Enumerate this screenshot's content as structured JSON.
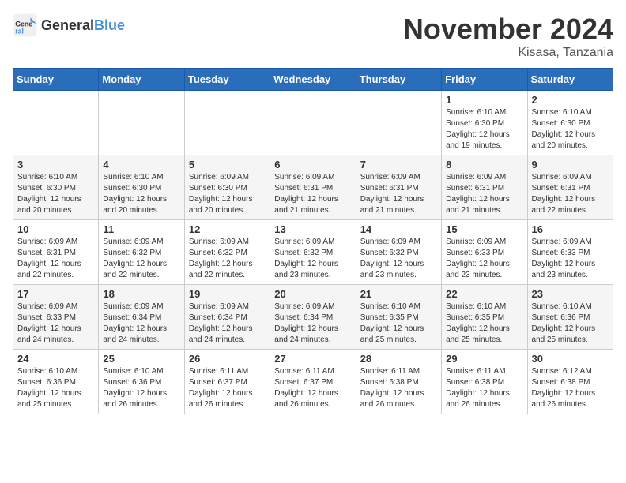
{
  "logo": {
    "general": "General",
    "blue": "Blue"
  },
  "header": {
    "month": "November 2024",
    "location": "Kisasa, Tanzania"
  },
  "weekdays": [
    "Sunday",
    "Monday",
    "Tuesday",
    "Wednesday",
    "Thursday",
    "Friday",
    "Saturday"
  ],
  "weeks": [
    [
      {
        "day": "",
        "info": ""
      },
      {
        "day": "",
        "info": ""
      },
      {
        "day": "",
        "info": ""
      },
      {
        "day": "",
        "info": ""
      },
      {
        "day": "",
        "info": ""
      },
      {
        "day": "1",
        "info": "Sunrise: 6:10 AM\nSunset: 6:30 PM\nDaylight: 12 hours and 19 minutes."
      },
      {
        "day": "2",
        "info": "Sunrise: 6:10 AM\nSunset: 6:30 PM\nDaylight: 12 hours and 20 minutes."
      }
    ],
    [
      {
        "day": "3",
        "info": "Sunrise: 6:10 AM\nSunset: 6:30 PM\nDaylight: 12 hours and 20 minutes."
      },
      {
        "day": "4",
        "info": "Sunrise: 6:10 AM\nSunset: 6:30 PM\nDaylight: 12 hours and 20 minutes."
      },
      {
        "day": "5",
        "info": "Sunrise: 6:09 AM\nSunset: 6:30 PM\nDaylight: 12 hours and 20 minutes."
      },
      {
        "day": "6",
        "info": "Sunrise: 6:09 AM\nSunset: 6:31 PM\nDaylight: 12 hours and 21 minutes."
      },
      {
        "day": "7",
        "info": "Sunrise: 6:09 AM\nSunset: 6:31 PM\nDaylight: 12 hours and 21 minutes."
      },
      {
        "day": "8",
        "info": "Sunrise: 6:09 AM\nSunset: 6:31 PM\nDaylight: 12 hours and 21 minutes."
      },
      {
        "day": "9",
        "info": "Sunrise: 6:09 AM\nSunset: 6:31 PM\nDaylight: 12 hours and 22 minutes."
      }
    ],
    [
      {
        "day": "10",
        "info": "Sunrise: 6:09 AM\nSunset: 6:31 PM\nDaylight: 12 hours and 22 minutes."
      },
      {
        "day": "11",
        "info": "Sunrise: 6:09 AM\nSunset: 6:32 PM\nDaylight: 12 hours and 22 minutes."
      },
      {
        "day": "12",
        "info": "Sunrise: 6:09 AM\nSunset: 6:32 PM\nDaylight: 12 hours and 22 minutes."
      },
      {
        "day": "13",
        "info": "Sunrise: 6:09 AM\nSunset: 6:32 PM\nDaylight: 12 hours and 23 minutes."
      },
      {
        "day": "14",
        "info": "Sunrise: 6:09 AM\nSunset: 6:32 PM\nDaylight: 12 hours and 23 minutes."
      },
      {
        "day": "15",
        "info": "Sunrise: 6:09 AM\nSunset: 6:33 PM\nDaylight: 12 hours and 23 minutes."
      },
      {
        "day": "16",
        "info": "Sunrise: 6:09 AM\nSunset: 6:33 PM\nDaylight: 12 hours and 23 minutes."
      }
    ],
    [
      {
        "day": "17",
        "info": "Sunrise: 6:09 AM\nSunset: 6:33 PM\nDaylight: 12 hours and 24 minutes."
      },
      {
        "day": "18",
        "info": "Sunrise: 6:09 AM\nSunset: 6:34 PM\nDaylight: 12 hours and 24 minutes."
      },
      {
        "day": "19",
        "info": "Sunrise: 6:09 AM\nSunset: 6:34 PM\nDaylight: 12 hours and 24 minutes."
      },
      {
        "day": "20",
        "info": "Sunrise: 6:09 AM\nSunset: 6:34 PM\nDaylight: 12 hours and 24 minutes."
      },
      {
        "day": "21",
        "info": "Sunrise: 6:10 AM\nSunset: 6:35 PM\nDaylight: 12 hours and 25 minutes."
      },
      {
        "day": "22",
        "info": "Sunrise: 6:10 AM\nSunset: 6:35 PM\nDaylight: 12 hours and 25 minutes."
      },
      {
        "day": "23",
        "info": "Sunrise: 6:10 AM\nSunset: 6:36 PM\nDaylight: 12 hours and 25 minutes."
      }
    ],
    [
      {
        "day": "24",
        "info": "Sunrise: 6:10 AM\nSunset: 6:36 PM\nDaylight: 12 hours and 25 minutes."
      },
      {
        "day": "25",
        "info": "Sunrise: 6:10 AM\nSunset: 6:36 PM\nDaylight: 12 hours and 26 minutes."
      },
      {
        "day": "26",
        "info": "Sunrise: 6:11 AM\nSunset: 6:37 PM\nDaylight: 12 hours and 26 minutes."
      },
      {
        "day": "27",
        "info": "Sunrise: 6:11 AM\nSunset: 6:37 PM\nDaylight: 12 hours and 26 minutes."
      },
      {
        "day": "28",
        "info": "Sunrise: 6:11 AM\nSunset: 6:38 PM\nDaylight: 12 hours and 26 minutes."
      },
      {
        "day": "29",
        "info": "Sunrise: 6:11 AM\nSunset: 6:38 PM\nDaylight: 12 hours and 26 minutes."
      },
      {
        "day": "30",
        "info": "Sunrise: 6:12 AM\nSunset: 6:38 PM\nDaylight: 12 hours and 26 minutes."
      }
    ]
  ]
}
